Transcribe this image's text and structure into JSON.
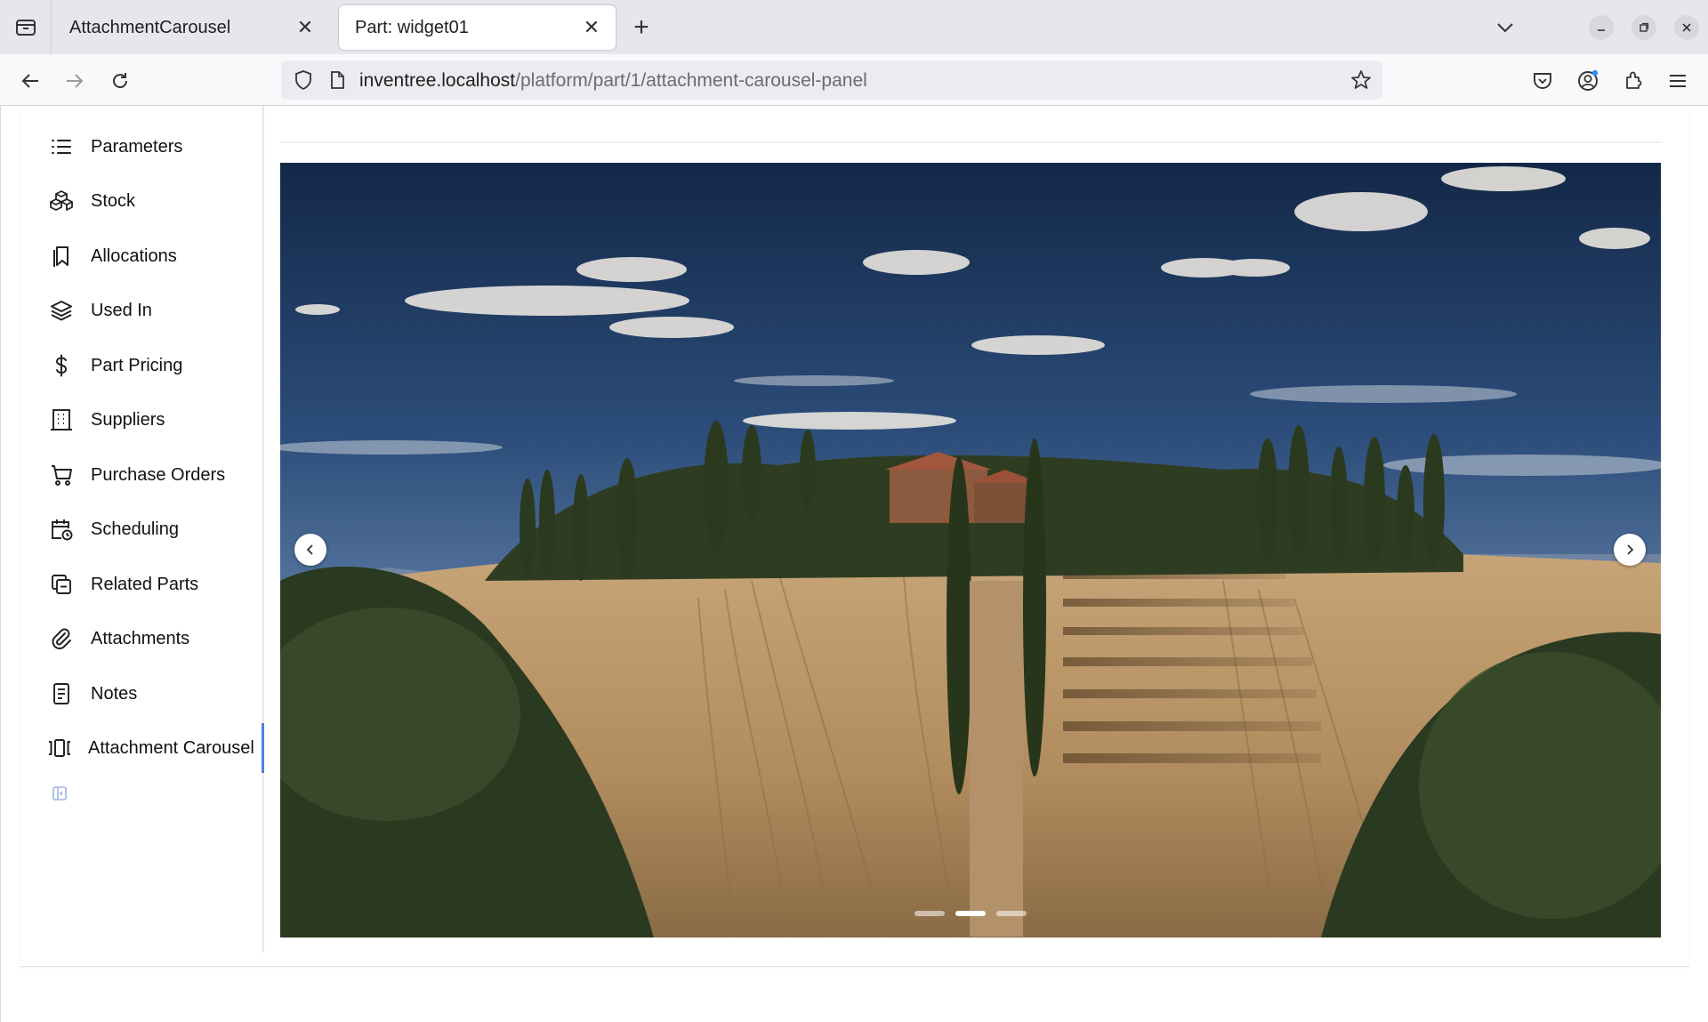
{
  "browser": {
    "tabs": [
      {
        "title": "AttachmentCarousel",
        "active": false
      },
      {
        "title": "Part: widget01",
        "active": true
      }
    ],
    "url": {
      "host": "inventree.localhost",
      "path": "/platform/part/1/attachment-carousel-panel"
    },
    "icons": {
      "tab_list": "tab-list-icon",
      "new_tab": "plus-icon",
      "list_all_tabs": "chevron-down-icon",
      "back": "arrow-left-icon",
      "forward": "arrow-right-icon",
      "reload": "reload-icon",
      "tracking": "shield-icon",
      "page_info": "page-icon",
      "bookmark": "star-icon",
      "pocket": "pocket-icon",
      "account": "account-icon",
      "extensions": "puzzle-icon",
      "menu": "hamburger-icon"
    }
  },
  "sidebar": {
    "items": [
      {
        "label": "Parameters",
        "icon": "list-icon"
      },
      {
        "label": "Stock",
        "icon": "boxes-icon"
      },
      {
        "label": "Allocations",
        "icon": "bookmark-icon"
      },
      {
        "label": "Used In",
        "icon": "stack-icon"
      },
      {
        "label": "Part Pricing",
        "icon": "dollar-icon"
      },
      {
        "label": "Suppliers",
        "icon": "building-icon"
      },
      {
        "label": "Purchase Orders",
        "icon": "cart-icon"
      },
      {
        "label": "Scheduling",
        "icon": "calendar-clock-icon"
      },
      {
        "label": "Related Parts",
        "icon": "copy-icon"
      },
      {
        "label": "Attachments",
        "icon": "paperclip-icon"
      },
      {
        "label": "Notes",
        "icon": "note-icon"
      },
      {
        "label": "Attachment Carousel",
        "icon": "carousel-icon",
        "active": true
      }
    ],
    "collapse_icon": "sidebar-collapse-icon"
  },
  "carousel": {
    "slide_count": 3,
    "active_slide": 2,
    "prev_icon": "chevron-left-icon",
    "next_icon": "chevron-right-icon"
  },
  "colors": {
    "accent": "#4e7ee8",
    "chrome_bg": "#e8e6ec",
    "urlbar_bg": "#ecebef"
  }
}
